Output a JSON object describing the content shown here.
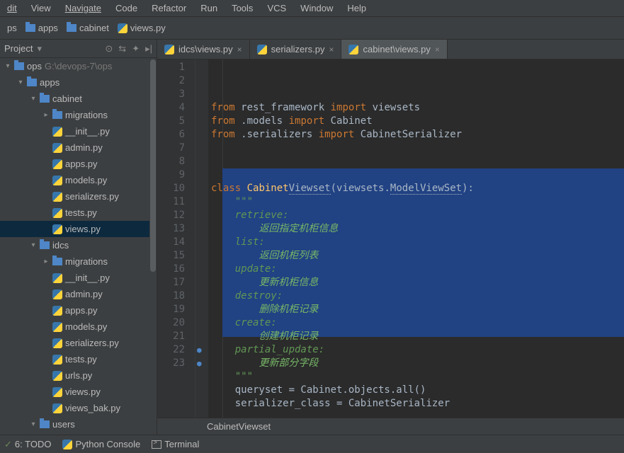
{
  "menu": [
    "dit",
    "View",
    "Navigate",
    "Code",
    "Refactor",
    "Run",
    "Tools",
    "VCS",
    "Window",
    "Help"
  ],
  "breadcrumb": [
    {
      "kind": "label",
      "text": "ps"
    },
    {
      "kind": "folder",
      "text": "apps"
    },
    {
      "kind": "folder",
      "text": "cabinet"
    },
    {
      "kind": "py",
      "text": "views.py"
    }
  ],
  "project": {
    "title": "Project",
    "root": {
      "name": "ops",
      "path": "G:\\devops-7\\ops"
    },
    "tree": [
      {
        "indent": 0,
        "arrow": "▾",
        "icon": "folder",
        "label": "ops",
        "extra": "G:\\devops-7\\ops"
      },
      {
        "indent": 1,
        "arrow": "▾",
        "icon": "folder",
        "label": "apps"
      },
      {
        "indent": 2,
        "arrow": "▾",
        "icon": "folder",
        "label": "cabinet"
      },
      {
        "indent": 3,
        "arrow": "▸",
        "icon": "folder",
        "label": "migrations"
      },
      {
        "indent": 3,
        "arrow": "",
        "icon": "py",
        "label": "__init__.py"
      },
      {
        "indent": 3,
        "arrow": "",
        "icon": "py",
        "label": "admin.py"
      },
      {
        "indent": 3,
        "arrow": "",
        "icon": "py",
        "label": "apps.py"
      },
      {
        "indent": 3,
        "arrow": "",
        "icon": "py",
        "label": "models.py"
      },
      {
        "indent": 3,
        "arrow": "",
        "icon": "py",
        "label": "serializers.py"
      },
      {
        "indent": 3,
        "arrow": "",
        "icon": "py",
        "label": "tests.py"
      },
      {
        "indent": 3,
        "arrow": "",
        "icon": "py",
        "label": "views.py",
        "selected": true
      },
      {
        "indent": 2,
        "arrow": "▾",
        "icon": "folder",
        "label": "idcs"
      },
      {
        "indent": 3,
        "arrow": "▸",
        "icon": "folder",
        "label": "migrations"
      },
      {
        "indent": 3,
        "arrow": "",
        "icon": "py",
        "label": "__init__.py"
      },
      {
        "indent": 3,
        "arrow": "",
        "icon": "py",
        "label": "admin.py"
      },
      {
        "indent": 3,
        "arrow": "",
        "icon": "py",
        "label": "apps.py"
      },
      {
        "indent": 3,
        "arrow": "",
        "icon": "py",
        "label": "models.py"
      },
      {
        "indent": 3,
        "arrow": "",
        "icon": "py",
        "label": "serializers.py"
      },
      {
        "indent": 3,
        "arrow": "",
        "icon": "py",
        "label": "tests.py"
      },
      {
        "indent": 3,
        "arrow": "",
        "icon": "py",
        "label": "urls.py"
      },
      {
        "indent": 3,
        "arrow": "",
        "icon": "py",
        "label": "views.py"
      },
      {
        "indent": 3,
        "arrow": "",
        "icon": "py",
        "label": "views_bak.py"
      },
      {
        "indent": 2,
        "arrow": "▾",
        "icon": "folder",
        "label": "users"
      }
    ]
  },
  "tabs": [
    {
      "label": "idcs\\views.py",
      "active": false
    },
    {
      "label": "serializers.py",
      "active": false
    },
    {
      "label": "cabinet\\views.py",
      "active": true
    }
  ],
  "code": {
    "lines": [
      {
        "n": 1,
        "html": "<span class='kw'>from</span> <span class='norm'>rest_framework</span> <span class='kw'>import</span> <span class='norm'>viewsets</span>"
      },
      {
        "n": 2,
        "html": "<span class='kw'>from</span> <span class='norm'>.models</span> <span class='kw'>import</span> <span class='norm'>Cabinet</span>"
      },
      {
        "n": 3,
        "html": "<span class='kw'>from</span> <span class='norm'>.serializers</span> <span class='kw'>import</span> <span class='norm'>CabinetSerializer</span>"
      },
      {
        "n": 4,
        "html": ""
      },
      {
        "n": 5,
        "html": ""
      },
      {
        "n": 6,
        "html": ""
      },
      {
        "n": 7,
        "html": "<span class='kw'>class</span> <span class='id'>Cabinet</span><span class='linkcls'>Viewset</span><span class='norm'>(viewsets.</span><span class='linkcls'>ModelViewSet</span><span class='norm'>):</span>"
      },
      {
        "n": 8,
        "html": "    <span class='doc'>\"\"\"</span>"
      },
      {
        "n": 9,
        "html": "    <span class='doc'>retrieve:</span>"
      },
      {
        "n": 10,
        "html": "        <span class='doctxt'>返回指定机柜信息</span>"
      },
      {
        "n": 11,
        "html": "    <span class='doc'>list:</span>"
      },
      {
        "n": 12,
        "html": "        <span class='doctxt'>返回机柜列表</span>"
      },
      {
        "n": 13,
        "html": "    <span class='doc'>update:</span>"
      },
      {
        "n": 14,
        "html": "        <span class='doctxt'>更新机柜信息</span>"
      },
      {
        "n": 15,
        "html": "    <span class='doc'>destroy:</span>"
      },
      {
        "n": 16,
        "html": "        <span class='doctxt'>删除机柜记录</span>"
      },
      {
        "n": 17,
        "html": "    <span class='doc'>create:</span>"
      },
      {
        "n": 18,
        "html": "        <span class='doctxt'>创建机柜记录</span>"
      },
      {
        "n": 19,
        "html": "    <span class='doc'>partial_update:</span>"
      },
      {
        "n": 20,
        "html": "        <span class='doctxt'>更新部分字段</span>"
      },
      {
        "n": 21,
        "html": "    <span class='doc'>\"\"\"</span>"
      },
      {
        "n": 22,
        "html": "    <span class='norm'>queryset = Cabinet.objects.all()</span>",
        "mark": "o↑"
      },
      {
        "n": 23,
        "html": "    <span class='norm'>serializer_class = CabinetSerializer</span>",
        "mark": "o↑"
      }
    ],
    "selection": {
      "from": 9,
      "to": 21
    },
    "crumb": "CabinetViewset"
  },
  "bottom": [
    {
      "icon": "check",
      "label": "6: TODO"
    },
    {
      "icon": "py",
      "label": "Python Console"
    },
    {
      "icon": "term",
      "label": "Terminal"
    }
  ]
}
